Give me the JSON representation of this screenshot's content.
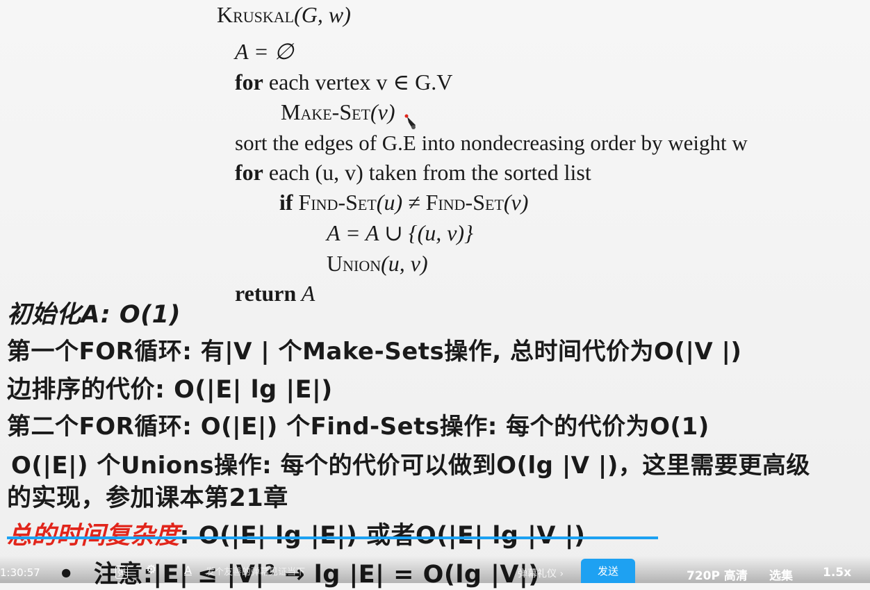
{
  "slide": {
    "algo": {
      "title_name": "Kruskal",
      "title_args": "(G, w)",
      "line1": "A = ∅",
      "for1_kw": "for",
      "for1_text": " each vertex v ∈ G.V",
      "make_set": "Make-Set",
      "make_set_arg": "(v)",
      "sort_line": "sort the edges of G.E into nondecreasing order by weight w",
      "for2_kw": "for",
      "for2_text": " each (u, v) taken from the sorted list",
      "if_kw": "if",
      "find_set_a": "Find-Set",
      "find_set_a_arg": "(u) ≠ ",
      "find_set_b": "Find-Set",
      "find_set_b_arg": "(v)",
      "assign": "A = A ∪ {(u, v)}",
      "union": "Union",
      "union_arg": "(u, v)",
      "return_kw": "return",
      "return_val": " A"
    },
    "notes": {
      "init": "初始化A: O(1)",
      "first_for": "第一个FOR循环: 有|V | 个Make-Sets操作, 总时间代价为O(|V |)",
      "sort_cost": "边排序的代价: O(|E| lg |E|)",
      "second_for": "第二个FOR循环: O(|E|) 个Find-Sets操作: 每个的代价为O(1)",
      "unions_1": "O(|E|) 个Unions操作: 每个的代价可以做到O(lg |V |)，这里需要更高级",
      "unions_2": "的实现，参加课本第21章",
      "total_label": "总的时间复杂度",
      "total_value": ": O(|E| lg |E|) 或者O(|E| lg |V |)",
      "bullet": "•",
      "attention": "注意:|E| ≤ |V|² → lg |E| = O(lg |V|)"
    }
  },
  "player": {
    "time": "1:30:57",
    "danmu_toggle": "弹",
    "danmu_settings": "⚙",
    "text_style": "A",
    "danmu_placeholder": "发个友善的弹幕见证当下",
    "etiquette": "弹幕礼仪 ›",
    "send": "发送",
    "quality": "720P 高清",
    "episodes": "选集",
    "speed": "1.5x",
    "progress_fraction": 0.75
  }
}
